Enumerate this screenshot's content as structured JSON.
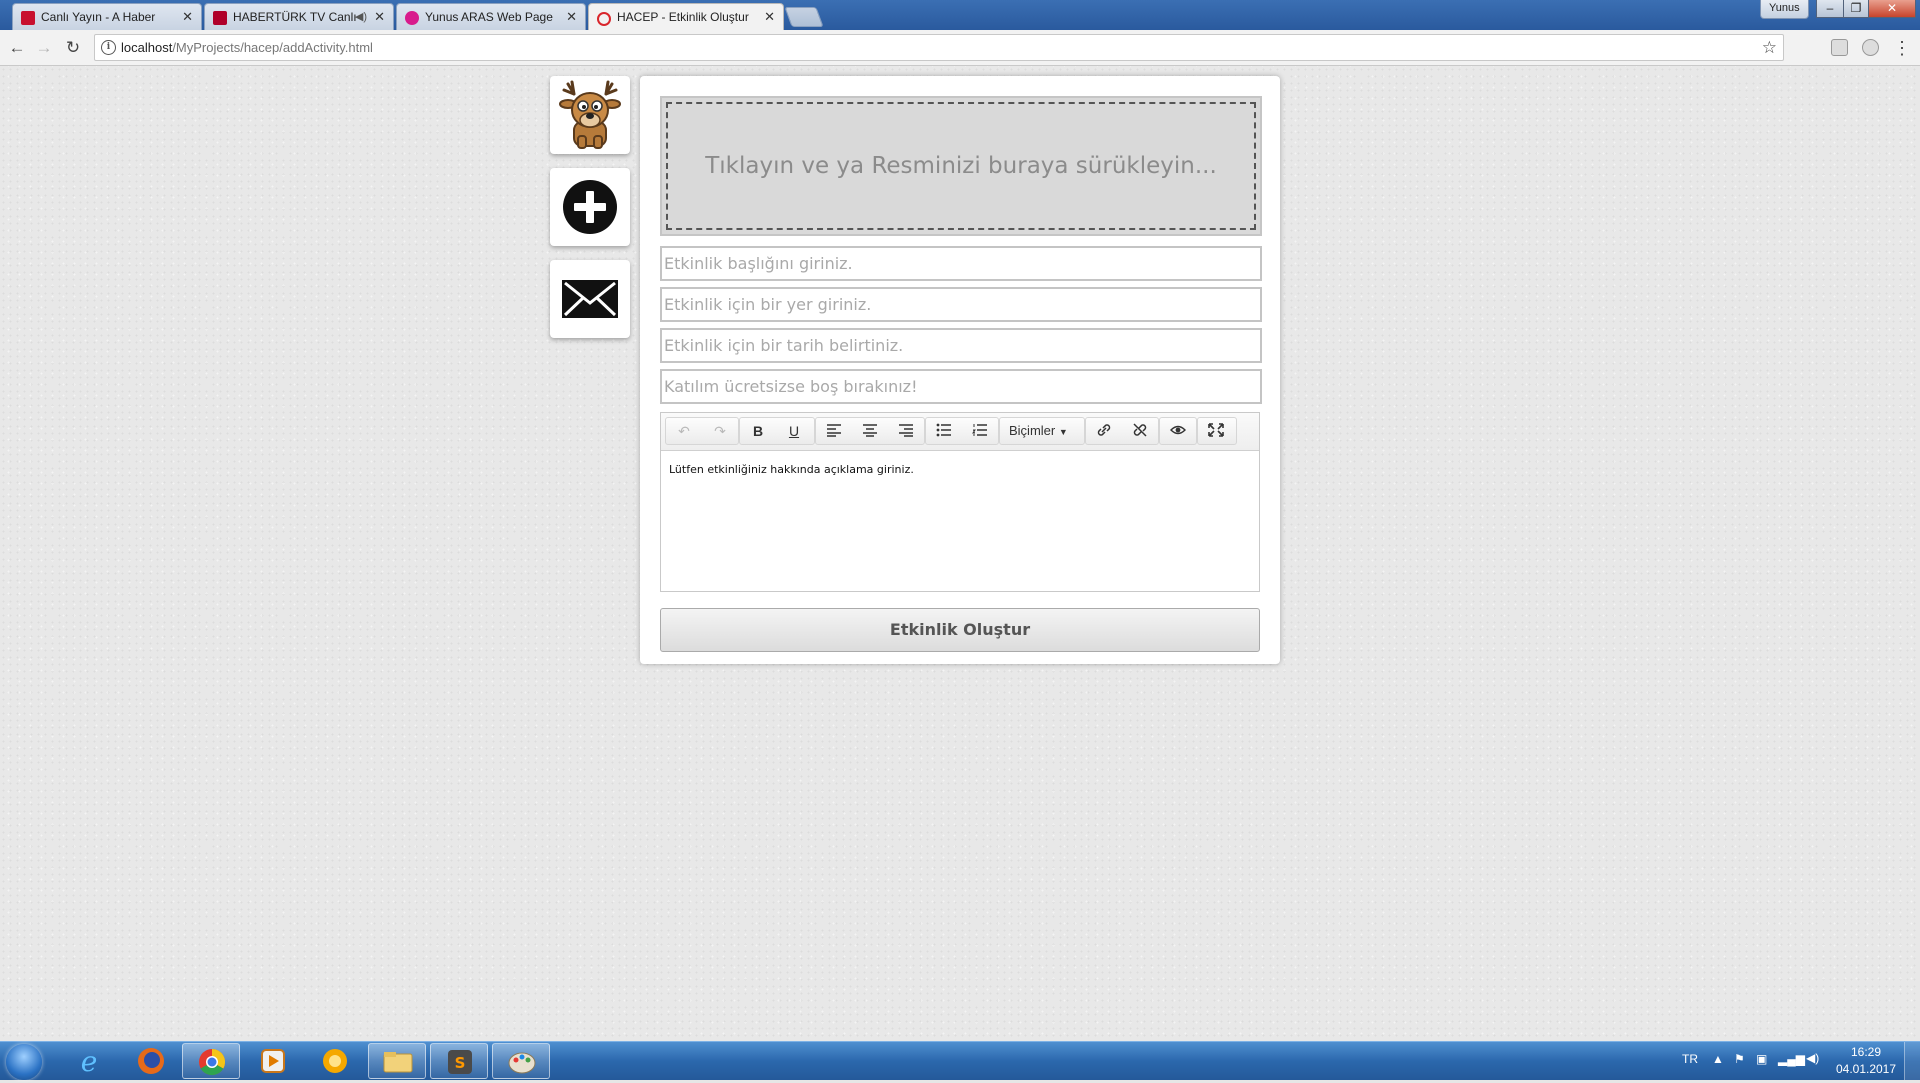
{
  "browser": {
    "tabs": [
      {
        "title": "Canlı Yayın - A Haber",
        "favicon_color": "#c8102e"
      },
      {
        "title": "HABERTÜRK TV Canlı",
        "favicon_color": "#b0002a"
      },
      {
        "title": "Yunus ARAS Web Page",
        "favicon_color": "#d81b8c"
      },
      {
        "title": "HACEP - Etkinlik Oluştur",
        "favicon_color": "#d9262c"
      }
    ],
    "user_name": "Yunus",
    "url_host": "localhost",
    "url_path": "/MyProjects/hacep/addActivity.html"
  },
  "sidebar": {
    "items": [
      {
        "icon": "deer-icon"
      },
      {
        "icon": "plus-circle-icon"
      },
      {
        "icon": "envelope-icon"
      }
    ]
  },
  "form": {
    "image_drop_text": "Tıklayın ve ya Resminizi buraya sürükleyin...",
    "title_placeholder": "Etkinlik başlığını giriniz.",
    "place_placeholder": "Etkinlik için bir yer giriniz.",
    "date_placeholder": "Etkinlik için bir tarih belirtiniz.",
    "fee_placeholder": "Katılım ücretsizse boş bırakınız!",
    "editor": {
      "formats_label": "Biçimler",
      "content": "Lütfen etkinliğiniz hakkında açıklama giriniz."
    },
    "submit_label": "Etkinlik Oluştur"
  },
  "taskbar": {
    "language": "TR",
    "time": "16:29",
    "date": "04.01.2017"
  },
  "colors": {
    "page_background": "#e8e8e8",
    "taskbar": "#2b68ad",
    "titlebar": "#2a5a9e"
  }
}
